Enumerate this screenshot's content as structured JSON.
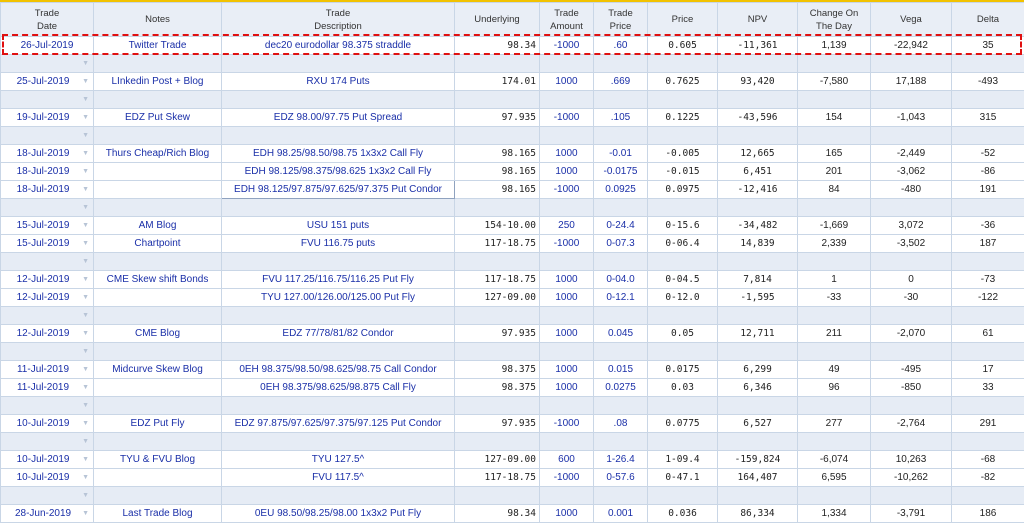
{
  "headers": {
    "date": [
      "Trade",
      "Date"
    ],
    "notes": [
      "Notes",
      ""
    ],
    "desc": [
      "Trade",
      "Description"
    ],
    "underlying": [
      "Underlying",
      ""
    ],
    "amount": [
      "Trade",
      "Amount"
    ],
    "tprice": [
      "Trade",
      "Price"
    ],
    "price": [
      "Price",
      ""
    ],
    "npv": [
      "NPV",
      ""
    ],
    "change": [
      "Change On",
      "The Day"
    ],
    "vega": [
      "Vega",
      ""
    ],
    "delta": [
      "Delta",
      ""
    ]
  },
  "rows": [
    {
      "kind": "data",
      "highlight": true,
      "date": "26-Jul-2019",
      "notes": "Twitter Trade",
      "desc": "dec20 eurodollar 98.375 straddle",
      "underlying": "98.34",
      "amount": "-1000",
      "tprice": ".60",
      "price": "0.605",
      "npv": "-11,361",
      "change": "1,139",
      "vega": "-22,942",
      "delta": "35",
      "dd": ""
    },
    {
      "kind": "sep"
    },
    {
      "kind": "data",
      "date": "25-Jul-2019",
      "notes": "LInkedin Post + Blog",
      "desc": "RXU 174 Puts",
      "underlying": "174.01",
      "amount": "1000",
      "tprice": ".669",
      "price": "0.7625",
      "npv": "93,420",
      "change": "-7,580",
      "vega": "17,188",
      "delta": "-493",
      "dd": "▼"
    },
    {
      "kind": "sep"
    },
    {
      "kind": "data",
      "date": "19-Jul-2019",
      "notes": "EDZ Put Skew",
      "desc": "EDZ 98.00/97.75 Put Spread",
      "underlying": "97.935",
      "amount": "-1000",
      "tprice": ".105",
      "price": "0.1225",
      "npv": "-43,596",
      "change": "154",
      "vega": "-1,043",
      "delta": "315",
      "dd": "▼"
    },
    {
      "kind": "sep"
    },
    {
      "kind": "data",
      "date": "18-Jul-2019",
      "notes": "Thurs Cheap/Rich Blog",
      "desc": "EDH 98.25/98.50/98.75 1x3x2 Call Fly",
      "underlying": "98.165",
      "amount": "1000",
      "tprice": "-0.01",
      "price": "-0.005",
      "npv": "12,665",
      "change": "165",
      "vega": "-2,449",
      "delta": "-52",
      "dd": "▼"
    },
    {
      "kind": "data",
      "date": "18-Jul-2019",
      "notes": "",
      "desc": "EDH 98.125/98.375/98.625 1x3x2 Call Fly",
      "underlying": "98.165",
      "amount": "1000",
      "tprice": "-0.0175",
      "price": "-0.015",
      "npv": "6,451",
      "change": "201",
      "vega": "-3,062",
      "delta": "-86",
      "dd": "▼"
    },
    {
      "kind": "data",
      "date": "18-Jul-2019",
      "notes": "",
      "desc": "EDH 98.125/97.875/97.625/97.375 Put Condor",
      "underlying": "98.165",
      "amount": "-1000",
      "tprice": "0.0925",
      "price": "0.0975",
      "npv": "-12,416",
      "change": "84",
      "vega": "-480",
      "delta": "191",
      "dd": "▼",
      "boxed": true
    },
    {
      "kind": "sep"
    },
    {
      "kind": "data",
      "date": "15-Jul-2019",
      "notes": "AM Blog",
      "desc": "USU 151 puts",
      "underlying": "154-10.00",
      "amount": "250",
      "tprice": "0-24.4",
      "price": "0-15.6",
      "npv": "-34,482",
      "change": "-1,669",
      "vega": "3,072",
      "delta": "-36",
      "dd": "▼"
    },
    {
      "kind": "data",
      "date": "15-Jul-2019",
      "notes": "Chartpoint",
      "desc": "FVU 116.75 puts",
      "underlying": "117-18.75",
      "amount": "-1000",
      "tprice": "0-07.3",
      "price": "0-06.4",
      "npv": "14,839",
      "change": "2,339",
      "vega": "-3,502",
      "delta": "187",
      "dd": "▼"
    },
    {
      "kind": "sep"
    },
    {
      "kind": "data",
      "date": "12-Jul-2019",
      "notes": "CME Skew shift Bonds",
      "desc": "FVU 117.25/116.75/116.25 Put Fly",
      "underlying": "117-18.75",
      "amount": "1000",
      "tprice": "0-04.0",
      "price": "0-04.5",
      "npv": "7,814",
      "change": "1",
      "vega": "0",
      "delta": "-73",
      "dd": "▼"
    },
    {
      "kind": "data",
      "date": "12-Jul-2019",
      "notes": "",
      "desc": "TYU 127.00/126.00/125.00 Put Fly",
      "underlying": "127-09.00",
      "amount": "1000",
      "tprice": "0-12.1",
      "price": "0-12.0",
      "npv": "-1,595",
      "change": "-33",
      "vega": "-30",
      "delta": "-122",
      "dd": "▼"
    },
    {
      "kind": "sep"
    },
    {
      "kind": "data",
      "date": "12-Jul-2019",
      "notes": "CME Blog",
      "desc": "EDZ 77/78/81/82 Condor",
      "underlying": "97.935",
      "amount": "1000",
      "tprice": "0.045",
      "price": "0.05",
      "npv": "12,711",
      "change": "211",
      "vega": "-2,070",
      "delta": "61",
      "dd": "▼"
    },
    {
      "kind": "sep"
    },
    {
      "kind": "data",
      "date": "11-Jul-2019",
      "notes": "Midcurve Skew Blog",
      "desc": "0EH 98.375/98.50/98.625/98.75 Call Condor",
      "underlying": "98.375",
      "amount": "1000",
      "tprice": "0.015",
      "price": "0.0175",
      "npv": "6,299",
      "change": "49",
      "vega": "-495",
      "delta": "17",
      "dd": "▼"
    },
    {
      "kind": "data",
      "date": "11-Jul-2019",
      "notes": "",
      "desc": "0EH 98.375/98.625/98.875 Call Fly",
      "underlying": "98.375",
      "amount": "1000",
      "tprice": "0.0275",
      "price": "0.03",
      "npv": "6,346",
      "change": "96",
      "vega": "-850",
      "delta": "33",
      "dd": "▼"
    },
    {
      "kind": "sep"
    },
    {
      "kind": "data",
      "date": "10-Jul-2019",
      "notes": "EDZ Put Fly",
      "desc": "EDZ 97.875/97.625/97.375/97.125 Put Condor",
      "underlying": "97.935",
      "amount": "-1000",
      "tprice": ".08",
      "price": "0.0775",
      "npv": "6,527",
      "change": "277",
      "vega": "-2,764",
      "delta": "291",
      "dd": "▼"
    },
    {
      "kind": "sep"
    },
    {
      "kind": "data",
      "date": "10-Jul-2019",
      "notes": "TYU & FVU Blog",
      "desc": "TYU 127.5^",
      "underlying": "127-09.00",
      "amount": "600",
      "tprice": "1-26.4",
      "price": "1-09.4",
      "npv": "-159,824",
      "change": "-6,074",
      "vega": "10,263",
      "delta": "-68",
      "dd": "▼"
    },
    {
      "kind": "data",
      "date": "10-Jul-2019",
      "notes": "",
      "desc": "FVU 117.5^",
      "underlying": "117-18.75",
      "amount": "-1000",
      "tprice": "0-57.6",
      "price": "0-47.1",
      "npv": "164,407",
      "change": "6,595",
      "vega": "-10,262",
      "delta": "-82",
      "dd": "▼"
    },
    {
      "kind": "sep"
    },
    {
      "kind": "data",
      "date": "28-Jun-2019",
      "notes": "Last Trade Blog",
      "desc": "0EU 98.50/98.25/98.00 1x3x2 Put Fly",
      "underlying": "98.34",
      "amount": "1000",
      "tprice": "0.001",
      "price": "0.036",
      "npv": "86,334",
      "change": "1,334",
      "vega": "-3,791",
      "delta": "186",
      "dd": "▼"
    }
  ]
}
